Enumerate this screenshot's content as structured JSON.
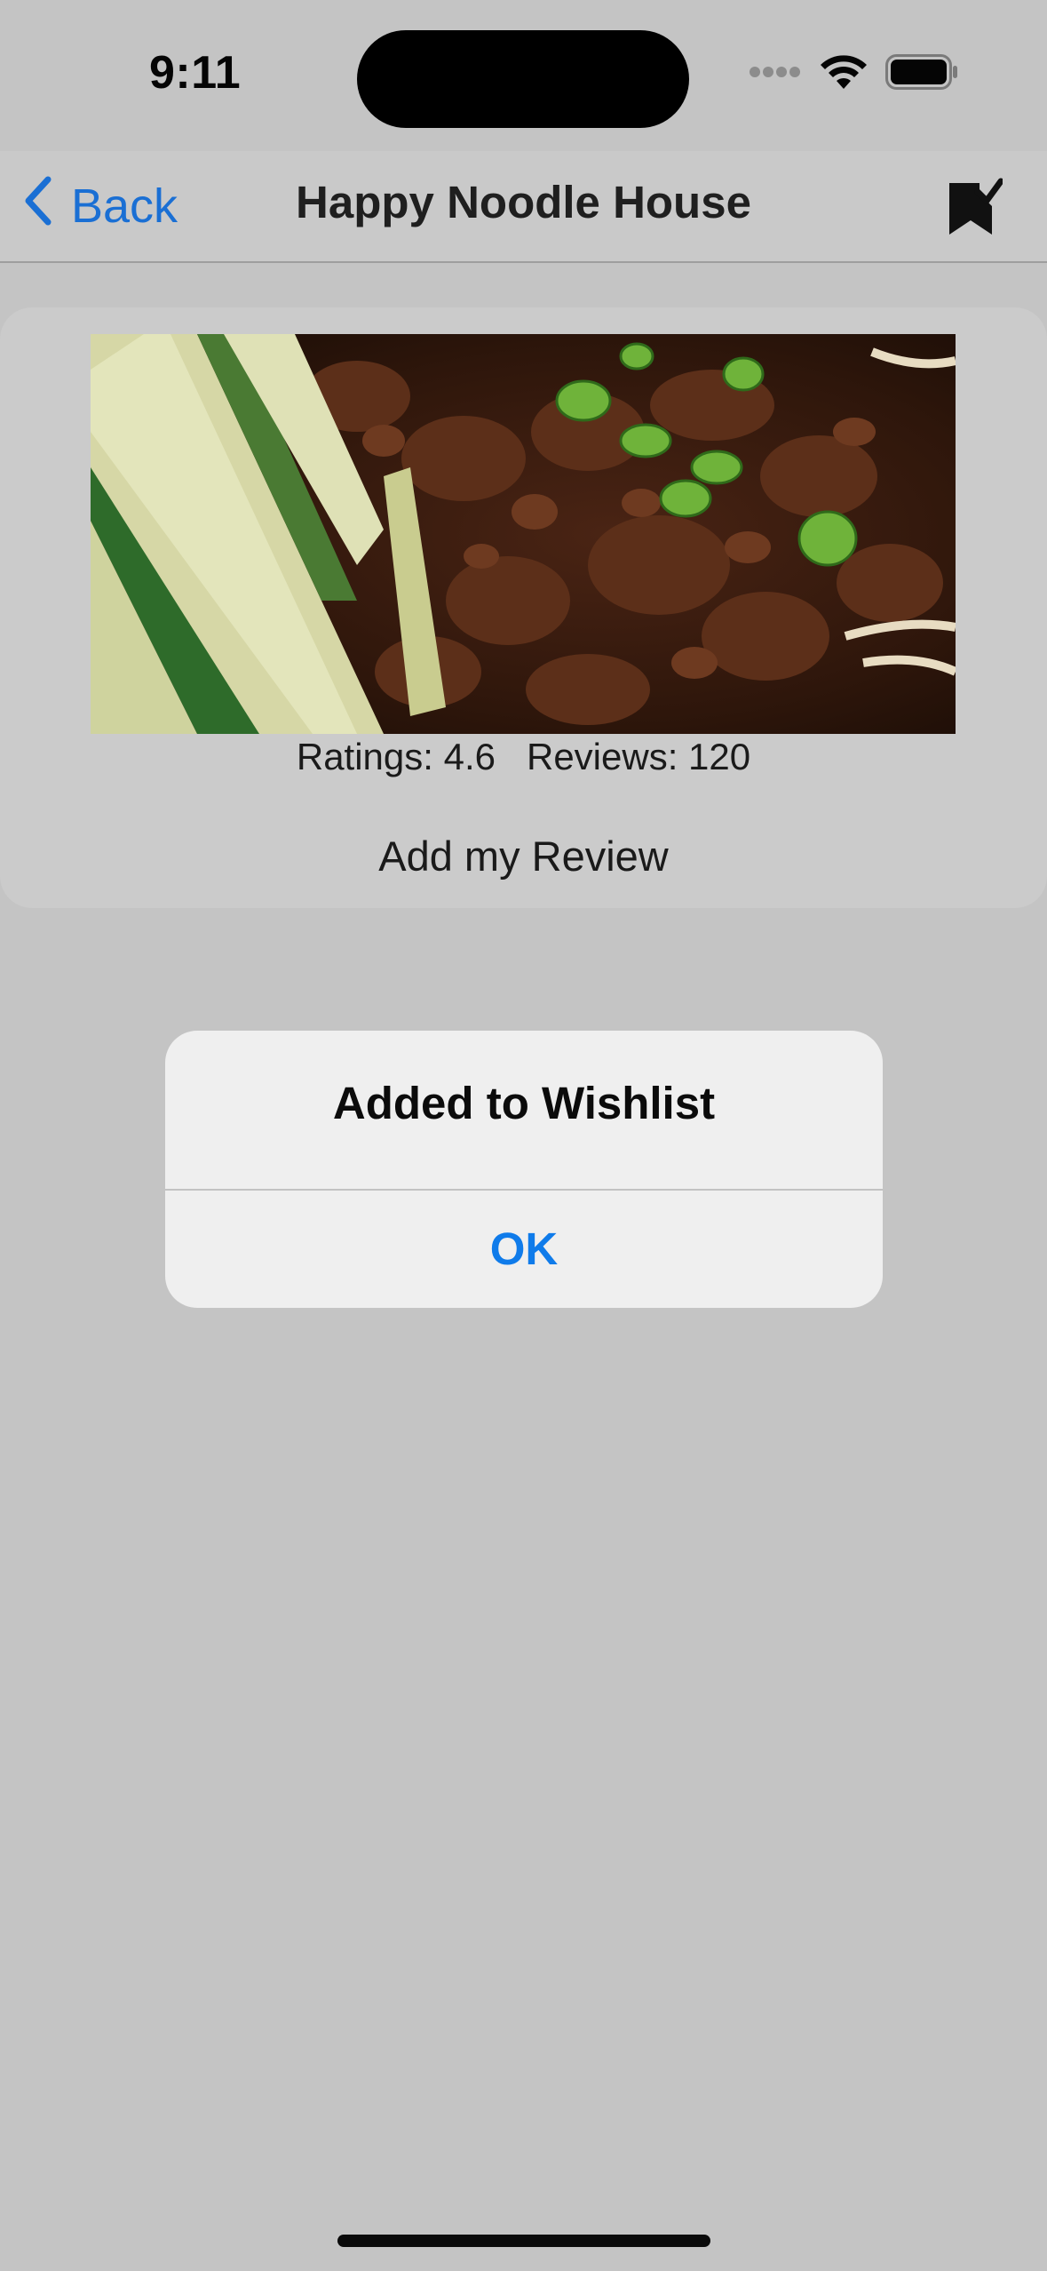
{
  "status_bar": {
    "time": "9:11"
  },
  "nav": {
    "back_label": "Back",
    "title": "Happy Noodle House",
    "bookmark_icon": "bookmark-check-icon"
  },
  "restaurant": {
    "image_description_icon": "food-photo",
    "stats_text": "Ratings: 4.6   Reviews: 120",
    "add_review_label": "Add my Review"
  },
  "alert": {
    "title": "Added to Wishlist",
    "ok_label": "OK"
  },
  "colors": {
    "accent": "#1a6fd4",
    "alert_button": "#0f7bea",
    "background": "#c4c4c4"
  }
}
